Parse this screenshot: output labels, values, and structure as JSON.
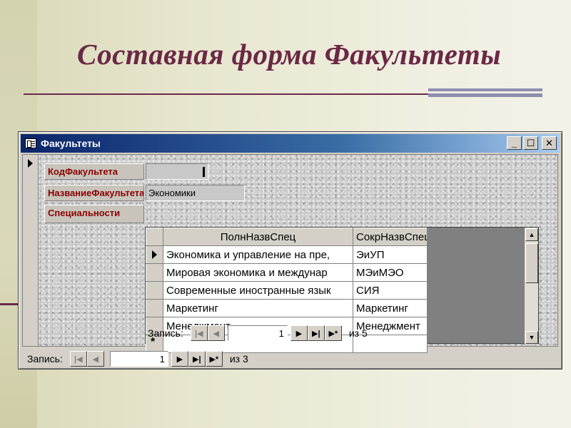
{
  "slide": {
    "title": "Составная форма Факультеты"
  },
  "window": {
    "title": "Факультеты",
    "buttons": {
      "minimize": "_",
      "maximize": "☐",
      "close": "✕"
    }
  },
  "form": {
    "fields": [
      {
        "label": "КодФакультета",
        "value": ""
      },
      {
        "label": "НазваниеФакультета",
        "value": "Экономики"
      },
      {
        "label": "Специальности"
      }
    ]
  },
  "subform": {
    "columns": [
      "ПолнНазвСпец",
      "СокрНазвСпец"
    ],
    "rows": [
      [
        "Экономика и управление на пре,",
        "ЭиУП"
      ],
      [
        "Мировая экономика и междунар",
        "МЭиМЭО"
      ],
      [
        "Современные иностранные язык",
        "СИЯ"
      ],
      [
        "Маркетинг",
        "Маркетинг"
      ],
      [
        "Менеджмент",
        "Менеджмент"
      ]
    ],
    "new_row_marker": "*",
    "navigator": {
      "label": "Запись:",
      "current": "1",
      "of_label": "из 5"
    }
  },
  "main_navigator": {
    "label": "Запись:",
    "current": "1",
    "of_label": "из 3"
  },
  "nav_glyphs": {
    "first": "|◀",
    "prev": "◀",
    "next": "▶",
    "last": "▶|",
    "new": "▶*"
  }
}
